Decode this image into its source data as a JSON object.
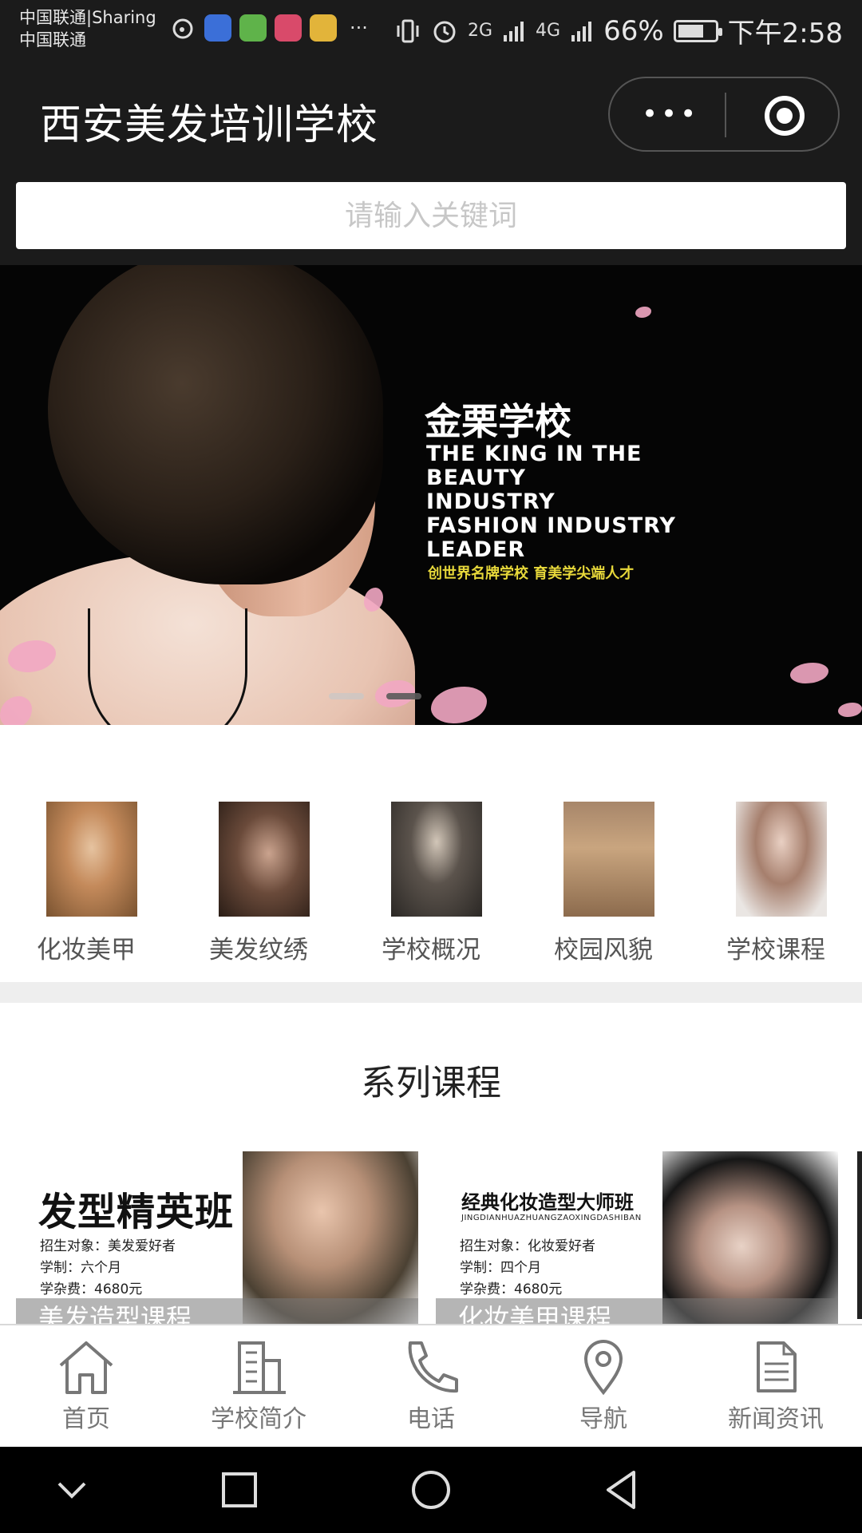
{
  "status_bar": {
    "carrier_line1": "中国联通|Sharing",
    "carrier_line2": "中国联通",
    "more": "···",
    "network_2g": "2G",
    "network_4g": "4G",
    "battery": "66%",
    "time": "下午2:58"
  },
  "nav": {
    "title": "西安美发培训学校",
    "menu_label": "•••"
  },
  "search": {
    "placeholder": "请输入关键词"
  },
  "banner": {
    "brand": "金栗学校",
    "english_lines": [
      "THE KING IN THE",
      "BEAUTY",
      "INDUSTRY",
      "FASHION INDUSTRY",
      "LEADER"
    ],
    "slogan": "创世界名牌学校 育美学尖端人才",
    "active_slide": 2,
    "slide_count": 2
  },
  "categories": [
    {
      "label": "化妆美甲"
    },
    {
      "label": "美发纹绣"
    },
    {
      "label": "学校概况"
    },
    {
      "label": "校园风貌"
    },
    {
      "label": "学校课程"
    }
  ],
  "section": {
    "title": "系列课程"
  },
  "courses": [
    {
      "headline": "发型精英班",
      "subtitle": "",
      "info": [
        "招生对象：美发爱好者",
        "学制：六个月",
        "学杂费：4680元"
      ],
      "overlay": "美发造型课程"
    },
    {
      "headline": "经典化妆造型大师班",
      "subtitle": "JINGDIANHUAZHUANGZAOXINGDASHIBAN",
      "info": [
        "招生对象：化妆爱好者",
        "学制：四个月",
        "学杂费：4680元"
      ],
      "overlay": "化妆美甲课程"
    }
  ],
  "tabbar": [
    {
      "label": "首页",
      "icon": "home-icon"
    },
    {
      "label": "学校简介",
      "icon": "building-icon"
    },
    {
      "label": "电话",
      "icon": "phone-icon"
    },
    {
      "label": "导航",
      "icon": "location-pin-icon"
    },
    {
      "label": "新闻资讯",
      "icon": "document-icon"
    }
  ],
  "colors": {
    "header_bg": "#1b1b1b",
    "tab_text": "#777777",
    "banner_slogan": "#e7d83a"
  }
}
